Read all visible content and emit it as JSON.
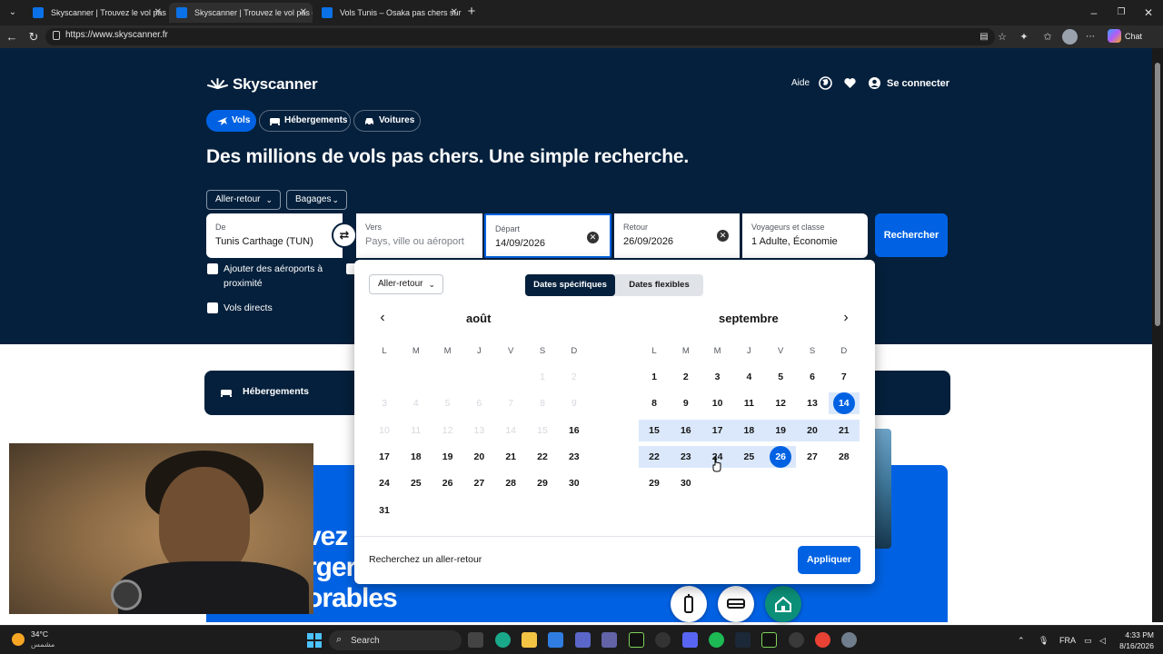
{
  "browser": {
    "tabs": [
      {
        "title": "Skyscanner | Trouvez le vol pas cher"
      },
      {
        "title": "Skyscanner | Trouvez le vol pas cher"
      },
      {
        "title": "Vols Tunis – Osaka pas chers sur Sky"
      }
    ],
    "url": "https://www.skyscanner.fr",
    "chat_label": "Chat"
  },
  "header": {
    "brand": "Skyscanner",
    "help": "Aide",
    "login": "Se connecter"
  },
  "modes": {
    "flights": "Vols",
    "hotels": "Hébergements",
    "cars": "Voitures"
  },
  "headline": "Des millions de vols pas chers. Une simple recherche.",
  "search": {
    "trip_type": "Aller-retour",
    "baggage": "Bagages",
    "from_label": "De",
    "from_value": "Tunis Carthage (TUN)",
    "to_label": "Vers",
    "to_placeholder": "Pays, ville ou aéroport",
    "depart_label": "Départ",
    "depart_value": "14/09/2026",
    "return_label": "Retour",
    "return_value": "26/09/2026",
    "travellers_label": "Voyageurs et classe",
    "travellers_value": "1 Adulte, Économie",
    "search_button": "Rechercher",
    "nearby_airports": "Ajouter des aéroports à proximité",
    "direct_flights": "Vols directs"
  },
  "datepicker": {
    "trip_type": "Aller-retour",
    "tab_specific": "Dates spécifiques",
    "tab_flexible": "Dates flexibles",
    "weekdays": [
      "L",
      "M",
      "M",
      "J",
      "V",
      "S",
      "D"
    ],
    "months": [
      {
        "name": "août",
        "first_weekday": 5,
        "days": 31,
        "enabled_from": 16
      },
      {
        "name": "septembre",
        "first_weekday": 0,
        "days": 30,
        "enabled_from": 1
      }
    ],
    "selected_start": 14,
    "selected_end": 26,
    "footer_text": "Recherchez un aller-retour",
    "apply_button": "Appliquer"
  },
  "below": {
    "band_label": "Hébergements",
    "promo_lines": [
      "vez c",
      "rger",
      "orables"
    ]
  },
  "taskbar": {
    "temperature": "34°C",
    "weather_sub": "مشمس",
    "search": "Search",
    "lang": "FRA",
    "time": "4:33 PM",
    "date": "8/16/2026"
  },
  "colors": {
    "brand_navy": "#05203c",
    "accent_blue": "#0062e3",
    "range_fill": "#dbe8fb"
  }
}
